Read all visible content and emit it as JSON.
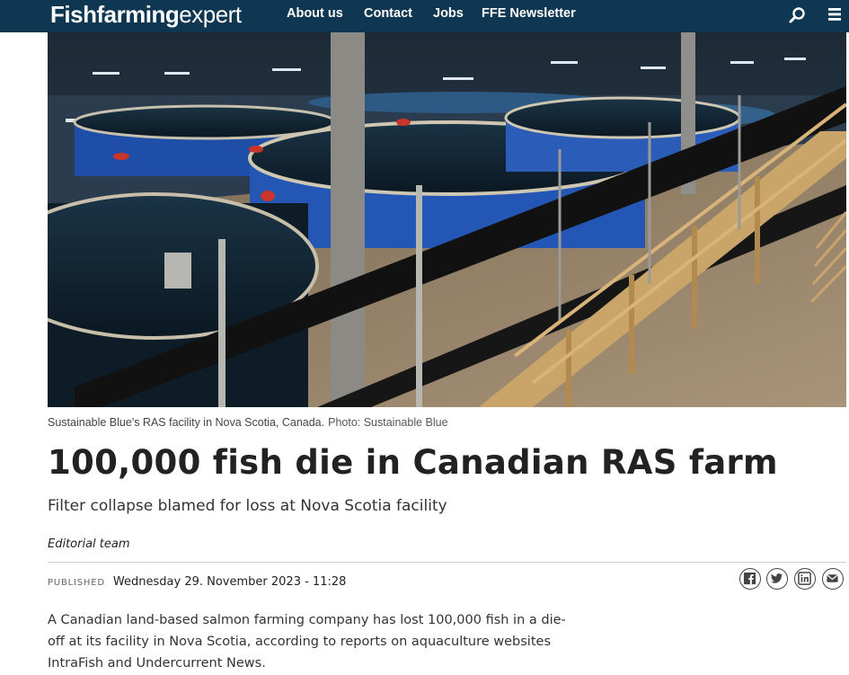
{
  "header": {
    "logo_bold": "Fishfarming",
    "logo_light": "expert",
    "nav": [
      "About us",
      "Contact",
      "Jobs",
      "FFE Newsletter"
    ],
    "search_icon": "search-icon",
    "menu_icon": "hamburger-menu-icon",
    "colors": {
      "background": "#0f3752",
      "text": "#ffffff"
    }
  },
  "hero": {
    "caption": "Sustainable Blue's RAS facility in Nova Scotia, Canada.",
    "credit": "Photo: Sustainable Blue"
  },
  "article": {
    "headline": "100,000 fish die in Canadian RAS farm",
    "subheading": "Filter collapse blamed for loss at Nova Scotia facility",
    "author": "Editorial team",
    "published_label": "PUBLISHED",
    "published_date": "Wednesday 29. November 2023 - 11:28",
    "share_icons": [
      "facebook-icon",
      "twitter-icon",
      "linkedin-icon",
      "email-icon"
    ],
    "body_lines": [
      "A Canadian land-based salmon farming company has lost 100,000 fish in a die-",
      "off at its facility in Nova Scotia, according to reports on aquaculture websites",
      "IntraFish and Undercurrent News."
    ]
  }
}
